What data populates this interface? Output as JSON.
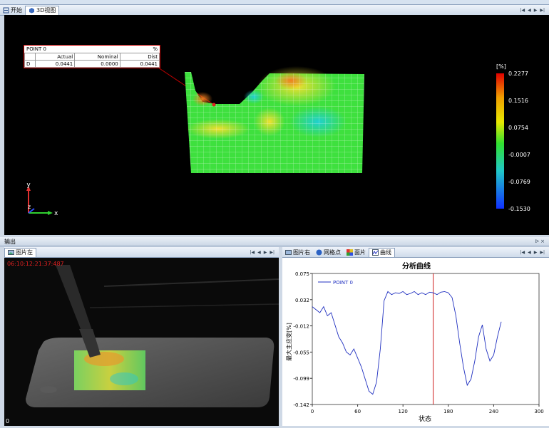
{
  "toolbar": {
    "window_title": ""
  },
  "top_tabs": {
    "start": "开始",
    "view3d": "3D视图"
  },
  "point_table": {
    "title": "POINT 0",
    "unit": "%",
    "headers": [
      "",
      "Actual",
      "Nominal",
      "Dist"
    ],
    "row": {
      "label": "D",
      "actual": "0.0441",
      "nominal": "0.0000",
      "dist": "0.0441"
    }
  },
  "legend": {
    "unit": "[%]",
    "ticks": [
      "0.2277",
      "0.1516",
      "0.0754",
      "-0.0007",
      "-0.0769",
      "-0.1530"
    ],
    "colors": [
      "#e00000",
      "#f0b000",
      "#e8e800",
      "#30e030",
      "#20c8c8",
      "#1040ff"
    ]
  },
  "axes": {
    "x": "x",
    "y": "y",
    "z": "z"
  },
  "output": {
    "title": "输出"
  },
  "left_pane": {
    "tab": "图片左",
    "timestamp": "06:10:12:21:37:487",
    "corner": "0"
  },
  "right_tabs": {
    "t1": "图片右",
    "t2": "网格点",
    "t3": "面片",
    "t4": "曲线"
  },
  "chart_data": {
    "type": "line",
    "title": "分析曲线",
    "xlabel": "状态",
    "ylabel": "最大主应变[%]",
    "xlim": [
      0,
      300
    ],
    "ylim": [
      -0.142,
      0.075
    ],
    "xticks": [
      "0",
      "60",
      "120",
      "180",
      "240",
      "300"
    ],
    "yticks": [
      "0.075",
      "0.032",
      "-0.012",
      "-0.055",
      "-0.099",
      "-0.142"
    ],
    "cursor_x": 160,
    "series": [
      {
        "name": "POINT 0",
        "color": "#2030c0",
        "x": [
          0,
          5,
          10,
          15,
          20,
          25,
          30,
          35,
          40,
          45,
          50,
          55,
          60,
          65,
          70,
          75,
          80,
          85,
          90,
          95,
          100,
          105,
          110,
          115,
          120,
          125,
          130,
          135,
          140,
          145,
          150,
          155,
          160,
          165,
          170,
          175,
          180,
          185,
          190,
          195,
          200,
          205,
          210,
          215,
          220,
          225,
          230,
          235,
          240,
          245,
          250
        ],
        "y": [
          0.02,
          0.015,
          0.01,
          0.02,
          0.005,
          0.01,
          -0.01,
          -0.03,
          -0.04,
          -0.055,
          -0.06,
          -0.05,
          -0.065,
          -0.08,
          -0.1,
          -0.12,
          -0.125,
          -0.105,
          -0.05,
          0.03,
          0.045,
          0.04,
          0.043,
          0.042,
          0.045,
          0.04,
          0.042,
          0.045,
          0.04,
          0.043,
          0.04,
          0.044,
          0.043,
          0.04,
          0.044,
          0.045,
          0.043,
          0.035,
          0.005,
          -0.04,
          -0.08,
          -0.11,
          -0.1,
          -0.07,
          -0.03,
          -0.01,
          -0.05,
          -0.07,
          -0.06,
          -0.03,
          -0.005
        ]
      }
    ]
  }
}
